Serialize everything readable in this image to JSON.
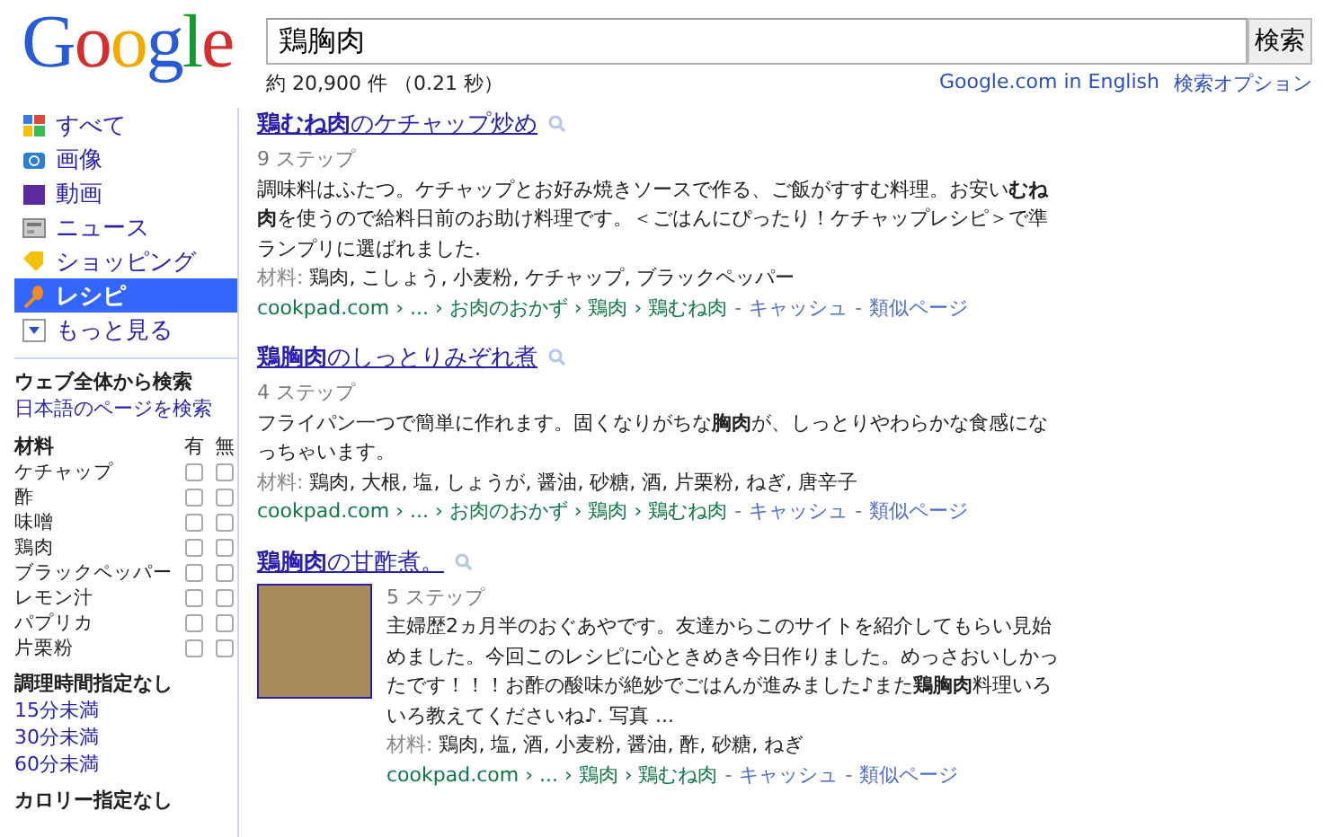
{
  "logo": "Google",
  "search": {
    "value": "鶏胸肉",
    "button": "検索"
  },
  "stats": "約 20,900 件 （0.21 秒）",
  "header_links": [
    "Google.com in English",
    "検索オプション"
  ],
  "sidebar": {
    "nav": [
      {
        "label": "すべて",
        "kind": "all",
        "selected": false
      },
      {
        "label": "画像",
        "kind": "images",
        "selected": false
      },
      {
        "label": "動画",
        "kind": "videos",
        "selected": false
      },
      {
        "label": "ニュース",
        "kind": "news",
        "selected": false
      },
      {
        "label": "ショッピング",
        "kind": "shopping",
        "selected": false
      },
      {
        "label": "レシピ",
        "kind": "recipes",
        "selected": true
      },
      {
        "label": "もっと見る",
        "kind": "more",
        "selected": false
      }
    ],
    "web_heading": "ウェブ全体から検索",
    "web_link": "日本語のページを検索",
    "ingredients": {
      "heading": "材料",
      "col_yes": "有",
      "col_no": "無",
      "items": [
        {
          "name": "ケチャップ",
          "yes": false,
          "no": false
        },
        {
          "name": "酢",
          "yes": false,
          "no": false
        },
        {
          "name": "味噌",
          "yes": false,
          "no": false
        },
        {
          "name": "鶏肉",
          "yes": false,
          "no": false
        },
        {
          "name": "ブラックペッパー",
          "yes": false,
          "no": false
        },
        {
          "name": "レモン汁",
          "yes": false,
          "no": false
        },
        {
          "name": "パプリカ",
          "yes": false,
          "no": false
        },
        {
          "name": "片栗粉",
          "yes": false,
          "no": false
        }
      ]
    },
    "time_heading": "調理時間指定なし",
    "time_links": [
      "15分未満",
      "30分未満",
      "60分未満"
    ],
    "calorie_heading": "カロリー指定なし"
  },
  "results": [
    {
      "title": "**鶏むね肉**のケチャップ炒め",
      "has_photo": false,
      "steps": "9 ステップ",
      "snippet": "調味料はふたつ。ケチャップとお好み焼きソースで作る、ご飯がすすむ料理。お安い**むね肉**を使うので給料日前のお助け料理です。＜ごはんにぴったり！ケチャップレシピ＞で準ランプリに選ばれました.",
      "ingredients_label": "材料:",
      "ingredients": "鶏肉, こしょう, 小麦粉, ケチャップ, ブラックペッパー",
      "url": "cookpad.com › ... › お肉のおかず › 鶏肉 › 鶏むね肉",
      "sep_1": "-",
      "cache": "キャッシュ",
      "sep_2": "-",
      "similar": "類似ページ"
    },
    {
      "title": "**鶏胸肉**のしっとりみぞれ煮",
      "has_photo": false,
      "steps": "4 ステップ",
      "snippet": "フライパン一つで簡単に作れます。固くなりがちな**胸肉**が、しっとりやわらかな食感になっちゃいます。",
      "ingredients_label": "材料:",
      "ingredients": "鶏肉, 大根, 塩, しょうが, 醤油, 砂糖, 酒, 片栗粉, ねぎ, 唐辛子",
      "url": "cookpad.com › ... › お肉のおかず › 鶏肉 › 鶏むね肉",
      "sep_1": "-",
      "cache": "キャッシュ",
      "sep_2": "-",
      "similar": "類似ページ"
    },
    {
      "title": "**鶏胸肉**の甘酢煮。",
      "has_photo": true,
      "steps": "5 ステップ",
      "snippet": "主婦歴2ヵ月半のおぐあやです。友達からこのサイトを紹介してもらい見始めました。今回このレシピに心ときめき今日作りました。めっさおいしかったです！！！お酢の酸味が絶妙でごはんが進みました♪また**鶏胸肉**料理いろいろ教えてくださいね♪. 写真 ...",
      "ingredients_label": "材料:",
      "ingredients": "鶏肉, 塩, 酒, 小麦粉, 醤油, 酢, 砂糖, ねぎ",
      "url": "cookpad.com › ... › 鶏肉 › 鶏むね肉",
      "sep_1": "-",
      "cache": "キャッシュ",
      "sep_2": "-",
      "similar": "類似ページ"
    }
  ]
}
